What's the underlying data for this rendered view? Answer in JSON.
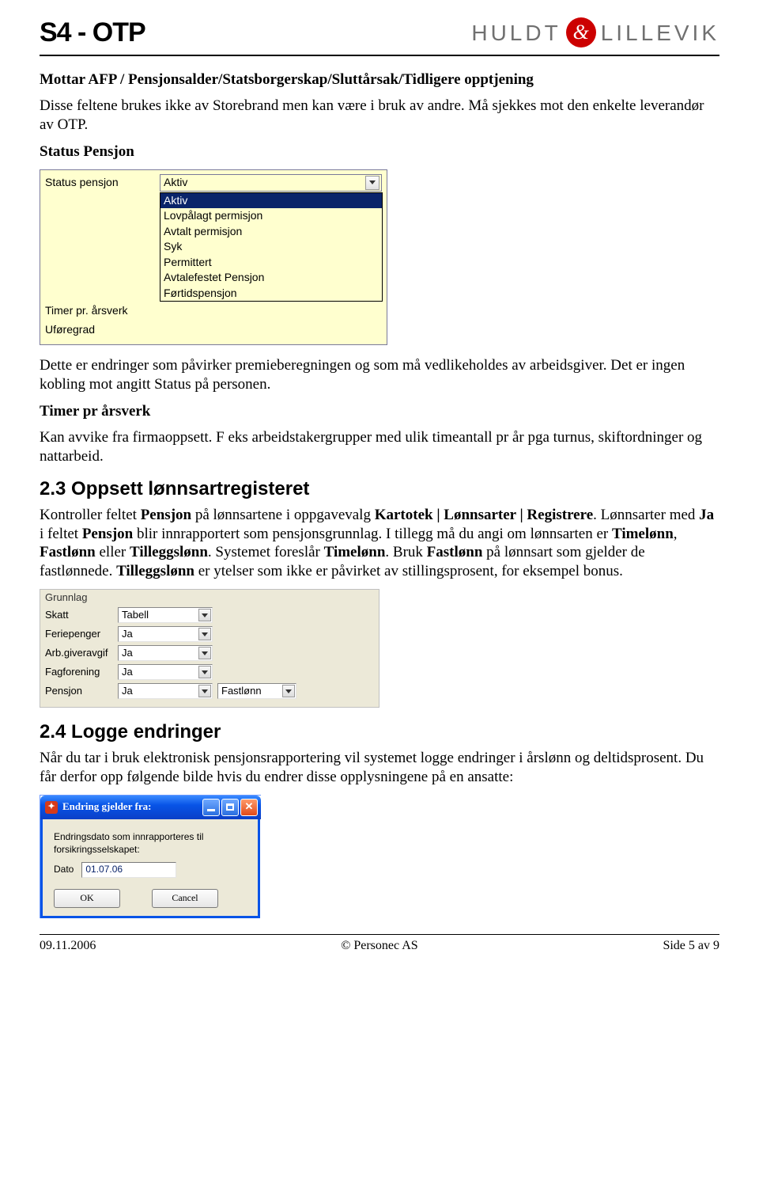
{
  "header": {
    "title": "S4 - OTP",
    "logo_left": "HULDT",
    "logo_amp": "&",
    "logo_right": "LILLEVIK"
  },
  "intro": {
    "h": "Mottar AFP / Pensjonsalder/Statsborgerskap/Sluttårsak/Tidligere opptjening",
    "p": "Disse feltene brukes ikke av Storebrand men kan være i bruk av andre. Må sjekkes mot den enkelte leverandør av OTP.",
    "status_h": "Status Pensjon"
  },
  "shot1": {
    "labels": {
      "status": "Status pensjon",
      "timer": "Timer pr. årsverk",
      "uforegrad": "Uføregrad"
    },
    "combo_value": "Aktiv",
    "options": [
      "Aktiv",
      "Lovpålagt permisjon",
      "Avtalt permisjon",
      "Syk",
      "Permittert",
      "Avtalefestet Pensjon",
      "Førtidspensjon"
    ]
  },
  "after1": {
    "p1": "Dette er endringer som påvirker premieberegningen og som må vedlikeholdes av arbeidsgiver. Det er ingen kobling mot angitt Status på personen.",
    "timer_h": "Timer pr årsverk",
    "p2": "Kan avvike fra firmaoppsett. F eks arbeidstakergrupper med ulik timeantall pr år pga turnus, skiftordninger og nattarbeid."
  },
  "sec23": {
    "h": "2.3 Oppsett lønnsartregisteret",
    "p": "Kontroller feltet Pensjon på lønnsartene i oppgavevalg Kartotek | Lønnsarter | Registrere. Lønnsarter med Ja i feltet Pensjon blir innrapportert som pensjonsgrunnlag. I tillegg må du angi om lønnsarten er Timelønn, Fastlønn eller Tilleggslønn. Systemet foreslår Timelønn. Bruk Fastlønn på lønnsart som gjelder de fastlønnede. Tilleggslønn er ytelser som ikke er påvirket av stillingsprosent, for eksempel bonus.",
    "b": {
      "pensjon": "Pensjon",
      "kart": "Kartotek | Lønnsarter | Registrere",
      "ja": "Ja",
      "time": "Timelønn",
      "fast": "Fastlønn",
      "till": "Tilleggslønn",
      "time2": "Timelønn",
      "fast2": "Fastlønn",
      "till2": "Tilleggslønn"
    }
  },
  "shot2": {
    "legend": "Grunnlag",
    "rows": {
      "skatt": {
        "label": "Skatt",
        "value": "Tabell"
      },
      "ferie": {
        "label": "Feriepenger",
        "value": "Ja"
      },
      "arbg": {
        "label": "Arb.giveravgif",
        "value": "Ja"
      },
      "fag": {
        "label": "Fagforening",
        "value": "Ja"
      },
      "pensjon": {
        "label": "Pensjon",
        "value": "Ja",
        "value2": "Fastlønn"
      }
    }
  },
  "sec24": {
    "h": "2.4 Logge endringer",
    "p": "Når du tar i bruk elektronisk pensjonsrapportering vil systemet logge endringer i årslønn og deltidsprosent. Du får derfor opp følgende bilde hvis du endrer disse opplysningene på en ansatte:"
  },
  "shot3": {
    "title": "Endring gjelder fra:",
    "body": "Endringsdato som innrapporteres til forsikringsselskapet:",
    "date_label": "Dato",
    "date_value": "01.07.06",
    "ok": "OK",
    "cancel": "Cancel"
  },
  "footer": {
    "date": "09.11.2006",
    "copyright": "© Personec AS",
    "page": "Side 5 av 9"
  }
}
